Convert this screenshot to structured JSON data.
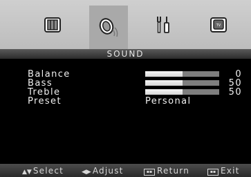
{
  "top_tabs": [
    {
      "icon": "picture-icon",
      "active": false
    },
    {
      "icon": "sound-icon",
      "active": true
    },
    {
      "icon": "tools-icon",
      "active": false
    },
    {
      "icon": "tv-icon",
      "active": false
    }
  ],
  "menu_title": "SOUND",
  "items": [
    {
      "label": "Balance",
      "value": "0",
      "level": 0.5
    },
    {
      "label": "Bass",
      "value": "50",
      "level": 0.5
    },
    {
      "label": "Treble",
      "value": "50",
      "level": 0.5
    },
    {
      "label": "Preset",
      "value": "Personal"
    }
  ],
  "footer": {
    "select": "Select",
    "adjust": "Adjust",
    "return": "Return",
    "exit": "Exit"
  },
  "colors": {
    "topbar": "#c6c6c6",
    "active_tab": "#a9a9a9",
    "bar_track": "#7e7e7e",
    "bar_fill": "#e8e8e8"
  }
}
